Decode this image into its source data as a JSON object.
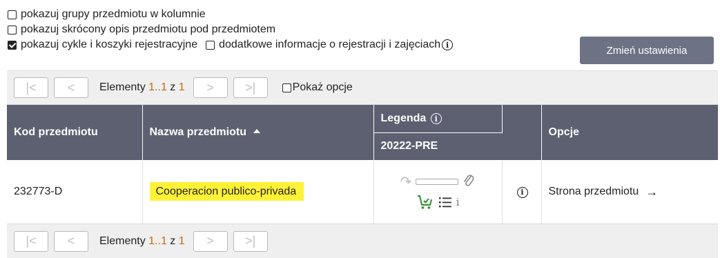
{
  "options": {
    "opt1": {
      "label": "pokazuj grupy przedmiotu w kolumnie",
      "checked": false
    },
    "opt2": {
      "label": "pokazuj skrócony opis przedmiotu pod przedmiotem",
      "checked": false
    },
    "opt3": {
      "label": "pokazuj cykle i koszyki rejestracyjne",
      "checked": true
    },
    "opt4": {
      "label": "dodatkowe informacje o rejestracji i zajęciach",
      "checked": false
    },
    "apply_button": "Zmień ustawienia"
  },
  "pager": {
    "elements_label": "Elementy",
    "range": "1..1",
    "of": "z",
    "total": "1",
    "show_options": "Pokaż opcje",
    "first_glyph": "|<",
    "prev_glyph": "<",
    "next_glyph": ">",
    "last_glyph": ">|"
  },
  "table": {
    "headers": {
      "code": "Kod przedmiotu",
      "name": "Nazwa przedmiotu",
      "legend": "Legenda",
      "cycle": "20222-PRE",
      "options": "Opcje"
    },
    "rows": [
      {
        "code": "232773-D",
        "name": "Cooperacion publico-privada",
        "link": "Strona przedmiotu",
        "link_arrow": "→"
      }
    ]
  },
  "colors": {
    "header_bg": "#5c6070",
    "button_bg": "#6d7384",
    "highlight": "#fff235",
    "range_accent": "#c46b00",
    "cart_green": "#2e8b2e"
  }
}
